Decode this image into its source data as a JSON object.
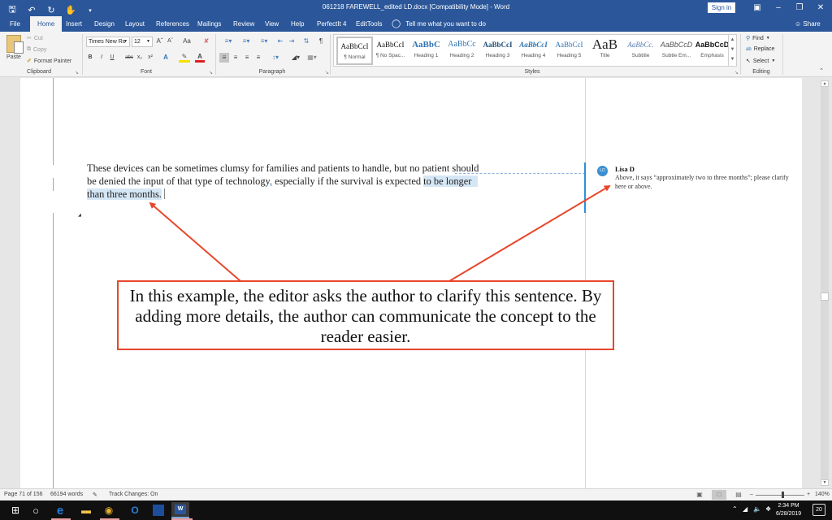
{
  "window": {
    "title": "061218 FAREWELL_edited LD.docx [Compatibility Mode]  -  Word",
    "sign_in": "Sign in",
    "controls": [
      "ribbon-display",
      "minimize",
      "restore",
      "close"
    ]
  },
  "quick_access": {
    "icons": [
      "save-icon",
      "undo-icon",
      "redo-icon",
      "touch-mode-icon",
      "customize-icon"
    ]
  },
  "tabs": [
    {
      "label": "File",
      "active": false
    },
    {
      "label": "Home",
      "active": true
    },
    {
      "label": "Insert",
      "active": false
    },
    {
      "label": "Design",
      "active": false
    },
    {
      "label": "Layout",
      "active": false
    },
    {
      "label": "References",
      "active": false
    },
    {
      "label": "Mailings",
      "active": false
    },
    {
      "label": "Review",
      "active": false
    },
    {
      "label": "View",
      "active": false
    },
    {
      "label": "Help",
      "active": false
    },
    {
      "label": "PerfectIt 4",
      "active": false
    },
    {
      "label": "EditTools",
      "active": false
    }
  ],
  "tell_me": "Tell me what you want to do",
  "share": "Share",
  "ribbon": {
    "clipboard": {
      "label": "Clipboard",
      "paste": "Paste",
      "cut": "Cut",
      "copy": "Copy",
      "format_painter": "Format Painter"
    },
    "font": {
      "label": "Font",
      "font_name": "Times New Ro",
      "font_size": "12",
      "grow": "Aˆ",
      "shrink": "Aˇ",
      "change_case": "Aa",
      "bold": "B",
      "italic": "I",
      "underline": "U",
      "strikethrough": "abc",
      "subscript": "x₂",
      "superscript": "x²",
      "text_effects": "A",
      "font_color": "A"
    },
    "paragraph": {
      "label": "Paragraph",
      "show_marks": "¶"
    },
    "styles": {
      "label": "Styles",
      "items": [
        {
          "sample": "AaBbCcI",
          "name": "¶ Normal",
          "active": true,
          "color": "#111111"
        },
        {
          "sample": "AaBbCcI",
          "name": "¶ No Spac...",
          "active": false,
          "color": "#111111"
        },
        {
          "sample": "AaBbC",
          "name": "Heading 1",
          "active": false,
          "color": "#2e74b5"
        },
        {
          "sample": "AaBbCc",
          "name": "Heading 2",
          "active": false,
          "color": "#2e74b5"
        },
        {
          "sample": "AaBbCcI",
          "name": "Heading 3",
          "active": false,
          "color": "#1f4e79"
        },
        {
          "sample": "AaBbCcI",
          "name": "Heading 4",
          "active": false,
          "color": "#2e74b5"
        },
        {
          "sample": "AaBbCcI",
          "name": "Heading 5",
          "active": false,
          "color": "#2e74b5"
        },
        {
          "sample": "AaB",
          "name": "Title",
          "active": false,
          "color": "#222222"
        },
        {
          "sample": "AaBbCc.",
          "name": "Subtitle",
          "active": false,
          "color": "#5a7fb5"
        },
        {
          "sample": "AaBbCcD",
          "name": "Subtle Em...",
          "active": false,
          "color": "#555555"
        },
        {
          "sample": "AaBbCcD",
          "name": "Emphasis",
          "active": false,
          "color": "#111111"
        }
      ]
    },
    "editing": {
      "label": "Editing",
      "find": "Find",
      "replace": "Replace",
      "select": "Select"
    }
  },
  "document": {
    "line1": "These devices can be sometimes clumsy for families and patients to handle, but no patient should",
    "line2_a": "be denied the input of that type of technology",
    "line2_comma": ",",
    "line2_b": " especially if the survival is expected ",
    "line2_hl": "to be longer",
    "line3_hl": "than three months.",
    "comment": {
      "initials": "LD",
      "author": "Lisa D",
      "text": "Above, it says “approximately two to three months”; please clarify here or above."
    }
  },
  "annotation": {
    "text": "In this example, the editor asks the author to clarify this sentence. By adding more details, the author can communicate the concept to the reader easier.",
    "color": "#e8472b"
  },
  "status_bar": {
    "page": "Page 71 of 156",
    "words": "66194 words",
    "track_changes": "Track Changes: On",
    "zoom_level": "140%",
    "zoom_percent": 140
  },
  "taskbar": {
    "apps": [
      "start-icon",
      "cortana-icon",
      "edge-icon",
      "file-explorer-icon",
      "chrome-icon",
      "outlook-icon",
      "weather-channel-icon",
      "word-icon"
    ],
    "time": "2:34 PM",
    "date": "6/28/2019",
    "notifications": "20"
  }
}
